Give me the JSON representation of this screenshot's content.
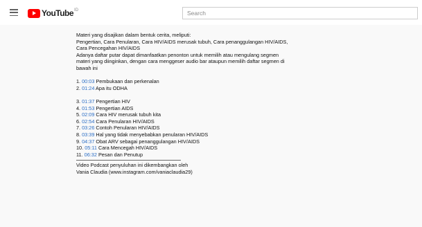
{
  "header": {
    "logo_text": "YouTube",
    "logo_region": "ID",
    "search_placeholder": "Search"
  },
  "description": {
    "intro": [
      "Materi yang disajikan dalam bentuk cerita, meliputi:",
      "Pengertian, Cara Penularan, Cara HIV/AIDS merusak tubuh, Cara penanggulangan HIV/AIDS,",
      "Cara Pencegahan HIV/AIDS",
      "Adanya daftar putar dapat dimanfaatkan penonton untuk memilih atau mengulang segmen",
      "materi yang diinginkan, dengan cara menggeser audio bar ataupun memilih daftar segmen di",
      "bawah ini"
    ],
    "chapters": [
      {
        "num": "1.",
        "time": "00:03",
        "title": "Pembukaan dan perkenalan"
      },
      {
        "num": "2.",
        "time": "01:24",
        "title": "Apa itu ODHA"
      },
      {
        "num": "3.",
        "time": "01:37",
        "title": "Pengertian HIV"
      },
      {
        "num": "4.",
        "time": "01:53",
        "title": "Pengertian AIDS"
      },
      {
        "num": "5.",
        "time": "02:09",
        "title": "Cara HIV merusak tubuh kita"
      },
      {
        "num": "6.",
        "time": "02:54",
        "title": "Cara Penularan HIV/AIDS"
      },
      {
        "num": "7.",
        "time": "03:26",
        "title": "Contoh Penularan HIV/AIDS"
      },
      {
        "num": "8.",
        "time": "03:39",
        "title": " Hal yang tidak menyebabkan penularan HIV/AIDS"
      },
      {
        "num": "9.",
        "time": "04:37",
        "title": "Obat ARV sebagai penanggulangan HIV/AIDS"
      },
      {
        "num": "10.",
        "time": "05:11",
        "title": "Cara Mencegah HIV/AIDS"
      },
      {
        "num": "11.",
        "time": "06:32",
        "title": "Pesan dan Penutup"
      }
    ],
    "footer": [
      "Video Podcast penyuluhan ini dikembangkan oleh",
      "Vania Claudia (www.instagram.com/vaniaclaudia29)"
    ]
  },
  "colors": {
    "timestamp_link": "#2a6dc5",
    "logo_red": "#ff0000"
  }
}
